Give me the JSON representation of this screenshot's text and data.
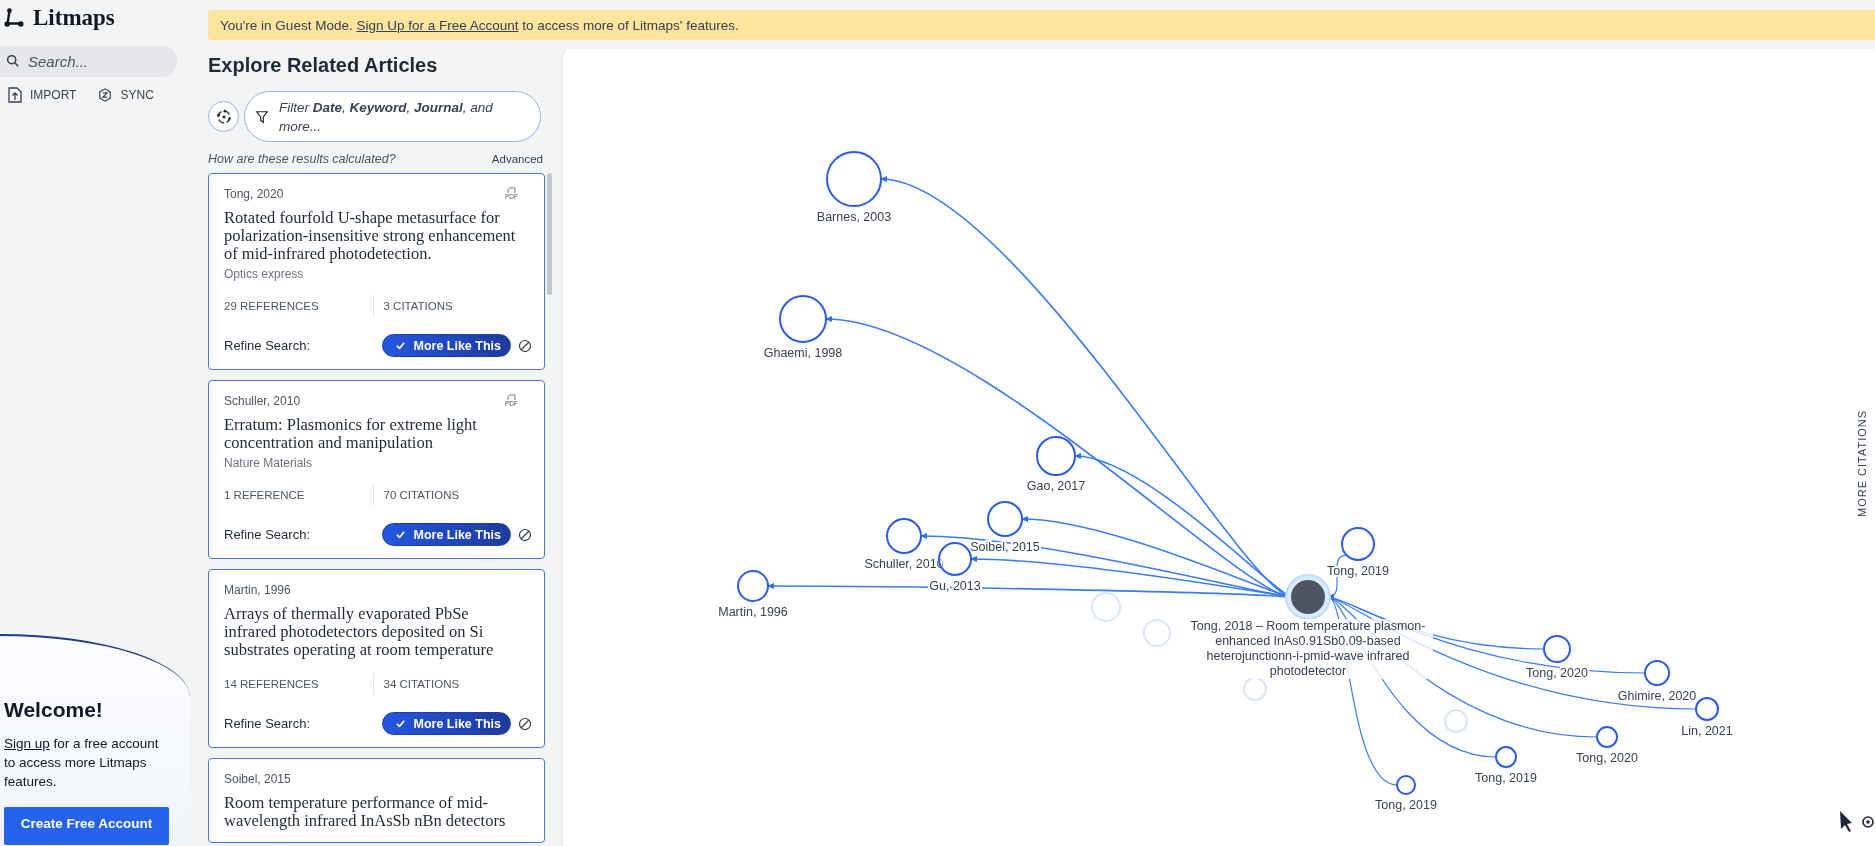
{
  "sidebar": {
    "logo": "Litmaps",
    "search": {
      "placeholder": "Search..."
    },
    "actions": [
      {
        "label": "IMPORT",
        "kind": "import"
      },
      {
        "label": "SYNC",
        "kind": "sync"
      }
    ],
    "welcome": {
      "title": "Welcome!",
      "link": "Sign up",
      "text": " for a free account to access more Litmaps features.",
      "button": "Create Free Account"
    }
  },
  "banner": {
    "before": "You're in Guest Mode. ",
    "link": "Sign Up for a Free Account",
    "after": " to access more of Litmaps' features."
  },
  "explore": {
    "title": "Explore Related Articles",
    "filter": "Filter **Date**, **Keyword**, **Journal**, and more...",
    "hint": "How are these results calculated?",
    "advanced": "Advanced",
    "cards": [
      {
        "author": "Tong, 2020",
        "pdf": "PDF",
        "title": "Rotated fourfold U-shape metasurface for polarization-insensitive strong enhancement of mid-infrared photodetection.",
        "journal": "Optics express",
        "references": "29  REFERENCES",
        "citations": "3  CITATIONS",
        "refine": "Refine Search:",
        "more_like_this": "More Like This",
        "liked": true
      },
      {
        "author": "Schuller, 2010",
        "pdf": "PDF",
        "title": "Erratum: Plasmonics for extreme light concentration and manipulation",
        "journal": "Nature Materials",
        "references": "1  REFERENCE",
        "citations": "70  CITATIONS",
        "refine": "Refine Search:",
        "more_like_this": "More Like This",
        "liked": true
      },
      {
        "author": "Martin, 1996",
        "title": "Arrays of thermally evaporated PbSe infrared photodetectors deposited on Si substrates operating at room temperature",
        "references": "14  REFERENCES",
        "citations": "34  CITATIONS",
        "refine": "Refine Search:",
        "more_like_this": "More Like This",
        "liked": true
      },
      {
        "author": "Soibel, 2015",
        "title": "Room temperature performance of mid-wavelength infrared InAsSb nBn detectors"
      }
    ]
  },
  "graph": {
    "seed": {
      "label": "Tong, 2018 – Room temperature plasmon-enhanced InAs0.91Sb0.09-based heterojunctionn-i-pmid-wave infrared photodetector"
    },
    "nodes": [
      {
        "label": "Barnes, 2003",
        "kind": "reference"
      },
      {
        "label": "Ghaemi, 1998",
        "kind": "reference"
      },
      {
        "label": "Gao, 2017",
        "kind": "reference"
      },
      {
        "label": "Soibel, 2015",
        "kind": "reference"
      },
      {
        "label": "Schuller, 2010",
        "kind": "reference"
      },
      {
        "label": "Gu, 2013",
        "kind": "reference"
      },
      {
        "label": "Martin, 1996",
        "kind": "reference"
      },
      {
        "label": "Tong, 2019",
        "kind": "citation"
      },
      {
        "label": "Tong, 2020",
        "kind": "citation"
      },
      {
        "label": "Ghimire, 2020",
        "kind": "citation"
      },
      {
        "label": "Lin, 2021",
        "kind": "citation"
      },
      {
        "label": "Tong, 2020",
        "kind": "citation"
      },
      {
        "label": "Tong, 2019",
        "kind": "citation"
      },
      {
        "label": "Tong, 2019",
        "kind": "citation"
      }
    ],
    "axis_label": "MORE CITATIONS"
  }
}
